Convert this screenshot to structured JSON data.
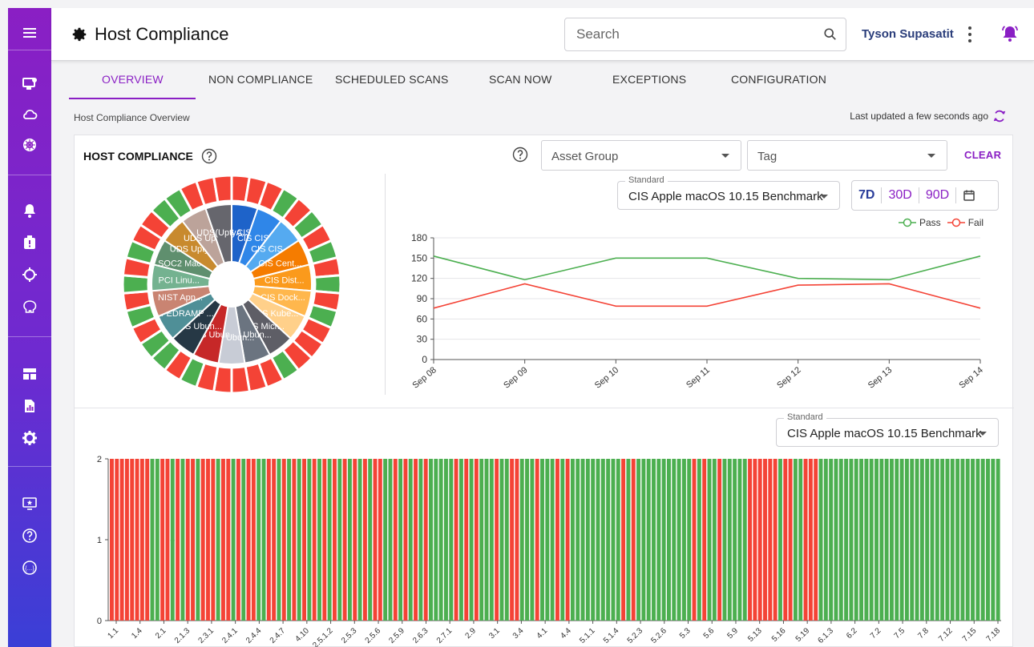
{
  "app": {
    "title": "Host Compliance"
  },
  "search": {
    "placeholder": "Search"
  },
  "user": {
    "name": "Tyson Supasatit"
  },
  "tabs": [
    {
      "label": "OVERVIEW",
      "active": true
    },
    {
      "label": "NON COMPLIANCE"
    },
    {
      "label": "SCHEDULED SCANS"
    },
    {
      "label": "SCAN NOW"
    },
    {
      "label": "EXCEPTIONS"
    },
    {
      "label": "CONFIGURATION"
    }
  ],
  "breadcrumb": "Host Compliance Overview",
  "last_updated": "Last updated a few seconds ago",
  "card": {
    "title": "HOST COMPLIANCE",
    "asset_group_placeholder": "Asset Group",
    "tag_placeholder": "Tag",
    "clear_label": "CLEAR"
  },
  "standard_selector_top": {
    "legend": "Standard",
    "value": "CIS Apple macOS 10.15 Benchmark"
  },
  "standard_selector_bottom": {
    "legend": "Standard",
    "value": "CIS Apple macOS 10.15 Benchmark"
  },
  "time_range": {
    "options": [
      "7D",
      "30D",
      "90D"
    ],
    "selected": "7D"
  },
  "colors": {
    "accent": "#8a1fc4",
    "pass": "#4caf50",
    "fail": "#f44336"
  },
  "chart_data": [
    {
      "type": "pie",
      "title": "",
      "slices": [
        {
          "label": "CIS CIS ...",
          "value": 1,
          "color": "#1e63c9"
        },
        {
          "label": "CIS CIS...",
          "value": 1,
          "color": "#2f86e8"
        },
        {
          "label": "CIS CIS...",
          "value": 1,
          "color": "#55aaf0"
        },
        {
          "label": "CIS Cent...",
          "value": 1,
          "color": "#f57c00"
        },
        {
          "label": "CIS Dist...",
          "value": 1,
          "color": "#fb9a1c"
        },
        {
          "label": "CIS Dock...",
          "value": 1,
          "color": "#ffb74d"
        },
        {
          "label": "CIS Kube...",
          "value": 1,
          "color": "#ffd08a"
        },
        {
          "label": "CIS Micr...",
          "value": 1,
          "color": "#5e5e66"
        },
        {
          "label": "CIS Ubun...",
          "value": 1,
          "color": "#6b7480"
        },
        {
          "label": "CIS Ubun...",
          "value": 1,
          "color": "#c8ccd6"
        },
        {
          "label": "CIS Ubun...",
          "value": 1,
          "color": "#c62828"
        },
        {
          "label": "CIS Ubun...",
          "value": 1,
          "color": "#263845"
        },
        {
          "label": "FEDRAMP ...",
          "value": 1,
          "color": "#4f8f97"
        },
        {
          "label": "NIST App...",
          "value": 1,
          "color": "#c98472"
        },
        {
          "label": "PCI Linu...",
          "value": 1,
          "color": "#74b290"
        },
        {
          "label": "SOC2 Mac...",
          "value": 1,
          "color": "#5f8f6e"
        },
        {
          "label": "UDS Upty...",
          "value": 1,
          "color": "#c88a2e"
        },
        {
          "label": "UDS Upty...",
          "value": 1,
          "color": "#bca39a"
        },
        {
          "label": "UDS(UptyA...",
          "value": 1,
          "color": "#66666d"
        }
      ],
      "outer_ring_note": "pass/fail split per benchmark",
      "outer_ring": [
        [
          "fail",
          "fail"
        ],
        [
          "fail",
          "pass"
        ],
        [
          "fail",
          "pass"
        ],
        [
          "fail",
          "pass"
        ],
        [
          "fail",
          "pass"
        ],
        [
          "fail",
          "pass"
        ],
        [
          "fail",
          "fail"
        ],
        [
          "fail",
          "pass"
        ],
        [
          "fail",
          "fail"
        ],
        [
          "fail",
          "fail"
        ],
        [
          "fail",
          "pass"
        ],
        [
          "fail",
          "pass"
        ],
        [
          "pass",
          "fail"
        ],
        [
          "pass",
          "fail"
        ],
        [
          "pass",
          "fail"
        ],
        [
          "pass",
          "fail"
        ],
        [
          "fail",
          "pass"
        ],
        [
          "pass",
          "fail"
        ],
        [
          "fail",
          "fail"
        ]
      ]
    },
    {
      "type": "line",
      "title": "",
      "x": [
        "Sep 08",
        "Sep 09",
        "Sep 10",
        "Sep 11",
        "Sep 12",
        "Sep 13",
        "Sep 14"
      ],
      "series": [
        {
          "name": "Pass",
          "values": [
            153,
            118,
            150,
            150,
            120,
            118,
            153
          ],
          "color": "#4caf50"
        },
        {
          "name": "Fail",
          "values": [
            76,
            112,
            79,
            79,
            110,
            112,
            76
          ],
          "color": "#f44336"
        }
      ],
      "ylim": [
        0,
        180
      ],
      "yticks": [
        0,
        30,
        60,
        90,
        120,
        150,
        180
      ],
      "legend": "top-right",
      "grid": true
    },
    {
      "type": "bar",
      "title": "",
      "ylim": [
        0,
        2
      ],
      "yticks": [
        0,
        1,
        2
      ],
      "bar_value": 2,
      "pattern_note": "each bar is 2 tall; color F=fail, P=pass; bar index 12 has a pass/fail split at value 1",
      "pattern": "FFFFFFFFPPFFPFPFFPFFFPFFPFPFFPPFFPFPFPFPFPFPFPFPFPFPFFPPFPFPFPFPPPPPFPFPFPPPFPPFFPPPFPPPFPFPPPPPPPPPPFPFPPPPPPPPPPPFPFPPFPPPPPFFFFFFPFFPPFFFPPPPPPPPPPPPPPPPPPPPPPPPPPPPPPPPPPPP",
      "xtick_labels": [
        "1.1",
        "1.4",
        "2.1",
        "2.1.3",
        "2.3.1",
        "2.4.1",
        "2.4.4",
        "2.4.7",
        "4.10",
        "2.5.1.2",
        "2.5.3",
        "2.5.6",
        "2.5.9",
        "2.6.3",
        "2.7.1",
        "2.9",
        "3.1",
        "3.4",
        "4.1",
        "4.4",
        "5.1.1",
        "5.1.4",
        "5.2.3",
        "5.2.6",
        "5.3",
        "5.6",
        "5.9",
        "5.13",
        "5.16",
        "5.19",
        "6.1.3",
        "6.2",
        "7.2",
        "7.5",
        "7.8",
        "7.12",
        "7.15",
        "7.18"
      ]
    }
  ]
}
